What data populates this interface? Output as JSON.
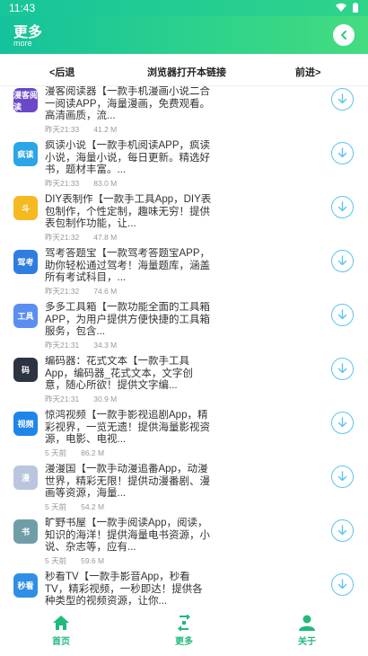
{
  "status": {
    "time": "11:43"
  },
  "header": {
    "title": "更多",
    "subtitle": "more"
  },
  "nav": {
    "back": "<后退",
    "open_in_browser": "浏览器打开本链接",
    "forward": "前进>"
  },
  "apps": [
    {
      "icon_text": "漫客阅读",
      "icon_color": "#6a48c8",
      "description": "漫客阅读器【一款手机漫画小说二合一阅读APP，海量漫画，免费观看。高清画质，流...",
      "time": "昨天21:33",
      "size": "41.2 M"
    },
    {
      "icon_text": "疯读",
      "icon_color": "#2aa5e8",
      "description": "疯读小说【一款手机阅读APP，疯读小说，海量小说，每日更新。精选好书，题材丰富。...",
      "time": "昨天21:33",
      "size": "83.0 M"
    },
    {
      "icon_text": "斗",
      "icon_color": "#f5b921",
      "description": "DIY表制作【一款手工具App，DIY表包制作，个性定制，趣味无穷！提供表包制作功能，让...",
      "time": "昨天21:32",
      "size": "47.8 M"
    },
    {
      "icon_text": "驾考",
      "icon_color": "#2f7de0",
      "description": "驾考答题宝【一款驾考答题宝APP，助你轻松通过驾考！海量题库，涵盖所有考试科目，...",
      "time": "昨天21:32",
      "size": "74.6 M"
    },
    {
      "icon_text": "工具",
      "icon_color": "#5a8ef0",
      "description": "多多工具箱【一款功能全面的工具箱APP，为用户提供方便快捷的工具箱服务，包含...",
      "time": "昨天21:31",
      "size": "34.3 M"
    },
    {
      "icon_text": "码",
      "icon_color": "#2b3440",
      "description": "编码器：花式文本【一款手工具App，编码器_花式文本，文字创意，随心所欲！提供文字编...",
      "time": "昨天21:31",
      "size": "30.9 M"
    },
    {
      "icon_text": "视频",
      "icon_color": "#1e86e8",
      "description": "惊鸿视频【一款手影视追剧App，精彩视界，一览无遗！提供海量影视资源，电影、电视...",
      "time": "5 天前",
      "size": "86.2 M"
    },
    {
      "icon_text": "漫",
      "icon_color": "#b9c6de",
      "description": "漫漫国【一款手动漫追番App，动漫世界，精彩无限！提供动漫番剧、漫画等资源，海量...",
      "time": "5 天前",
      "size": "54.2 M"
    },
    {
      "icon_text": "书",
      "icon_color": "#6f9ea8",
      "description": "旷野书屋【一款手阅读App，阅读，知识的海洋！提供海量电书资源，小说、杂志等，应有...",
      "time": "5 天前",
      "size": "59.6 M"
    },
    {
      "icon_text": "秒看",
      "icon_color": "#2f8fe6",
      "description": "秒看TV【一款手影音App，秒看TV，精彩视频，一秒即达！提供各种类型的视频资源，让你...",
      "time": "",
      "size": ""
    }
  ],
  "tabs": {
    "home": "首页",
    "more": "更多",
    "about": "关于"
  },
  "colors": {
    "accent": "#21b97c",
    "download": "#5bc4ee",
    "header_start": "#14c29c",
    "header_end": "#44dc80"
  }
}
